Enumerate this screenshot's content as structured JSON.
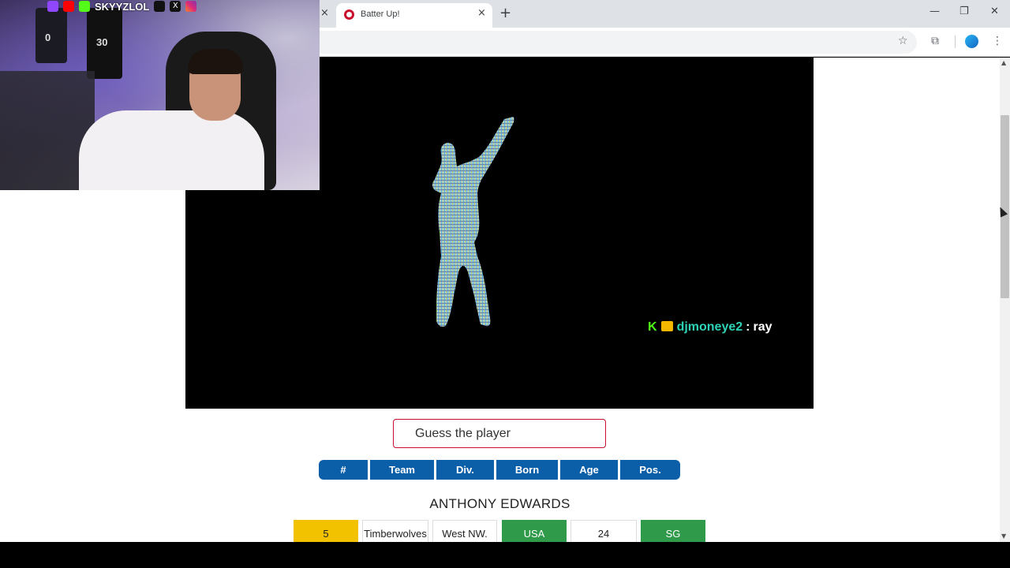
{
  "browser": {
    "tab_title": "Batter Up!",
    "tab_close": "×",
    "prev_tab_close": "×",
    "new_tab": "+",
    "window_min": "—",
    "window_max": "❐",
    "window_close": "✕",
    "star": "☆",
    "extensions": "⧉",
    "menu": "⋮"
  },
  "webcam": {
    "handle": "SKYYZLOL",
    "jersey_numbers": [
      "0",
      "30"
    ],
    "social_icons": [
      "twitch-icon",
      "youtube-icon",
      "kick-icon",
      "tiktok-icon",
      "x-icon",
      "instagram-icon"
    ],
    "x_glyph": "X"
  },
  "stage": {
    "chat": {
      "platform_badge": "K",
      "username": "djmoneye2",
      "separator": ":",
      "message": "ray"
    }
  },
  "game": {
    "guess_placeholder": "Guess the player",
    "headers": [
      "#",
      "Team",
      "Div.",
      "Born",
      "Age",
      "Pos."
    ],
    "player_name": "ANTHONY EDWARDS",
    "attributes": [
      {
        "value": "5",
        "status": "yellow"
      },
      {
        "value": "Timberwolves",
        "status": "none"
      },
      {
        "value": "West NW.",
        "status": "none"
      },
      {
        "value": "USA",
        "status": "green"
      },
      {
        "value": "24",
        "status": "none"
      },
      {
        "value": "SG",
        "status": "green"
      }
    ]
  },
  "colors": {
    "header_blue": "#0b5ea8",
    "match_green": "#2e9a4a",
    "close_yellow": "#f2c200",
    "input_border": "#c8102e",
    "chat_username": "#2ed3b7"
  }
}
